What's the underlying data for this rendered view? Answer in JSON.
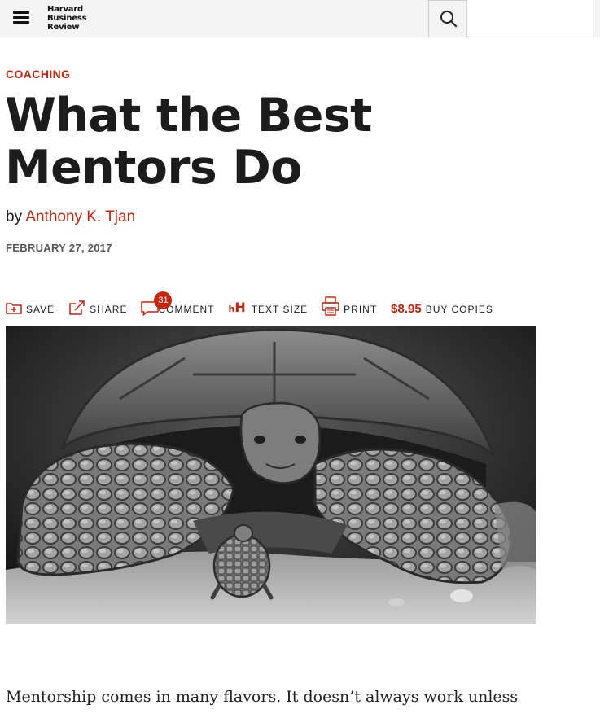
{
  "header": {
    "logo_lines": [
      "Harvard",
      "Business",
      "Review"
    ],
    "menu_icon": "hamburger-menu-icon",
    "search_icon": "search-icon",
    "search_placeholder": ""
  },
  "article": {
    "section": "COACHING",
    "title": "What the Best Mentors Do",
    "byline_prefix": "by",
    "author": "Anthony K. Tjan",
    "date": "FEBRUARY 27, 2017",
    "lede": "Mentorship comes in many flavors. It doesn’t always work unless"
  },
  "toolbar": {
    "save": "SAVE",
    "share": "SHARE",
    "comment": "COMMENT",
    "comment_count": "31",
    "text_size": "TEXT SIZE",
    "print": "PRINT",
    "price": "$8.95",
    "buy": "BUY COPIES"
  },
  "hero_image": {
    "kind": "black-and-white photo of a giant tortoise with a baby tortoise"
  },
  "colors": {
    "accent": "#c5240e",
    "header_bg": "#f4f4f4",
    "text": "#1c1c1c"
  }
}
